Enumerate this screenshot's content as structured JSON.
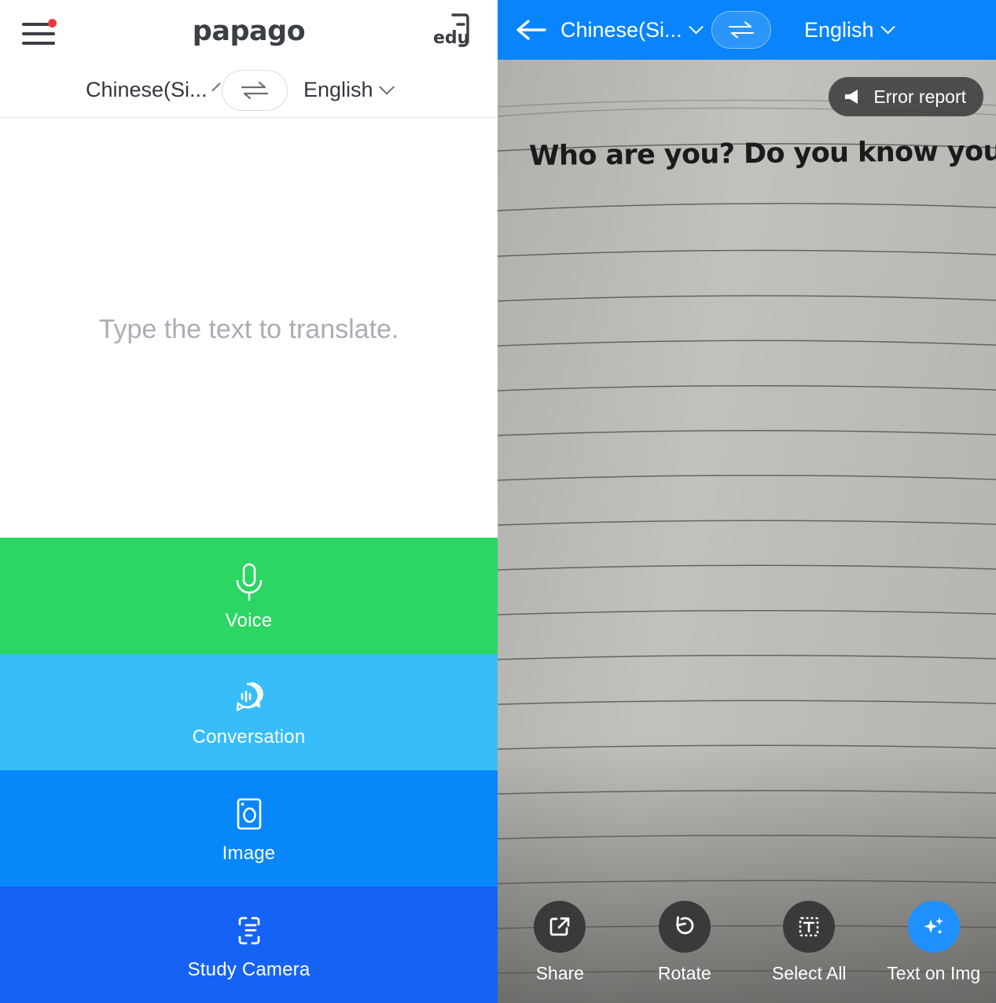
{
  "left": {
    "brand": "papago",
    "edu_label": "edu",
    "menu_icon": "hamburger-menu-icon",
    "source_language": "Chinese(Si...",
    "target_language": "English",
    "swap_icon": "swap-arrows-icon",
    "input_placeholder": "Type the text to translate.",
    "actions": [
      {
        "label": "Voice",
        "icon": "microphone-icon",
        "color": "#2bd662"
      },
      {
        "label": "Conversation",
        "icon": "conversation-bubbles-icon",
        "color": "#36bdfa"
      },
      {
        "label": "Image",
        "icon": "camera-icon",
        "color": "#0787f9"
      },
      {
        "label": "Study Camera",
        "icon": "scan-document-icon",
        "color": "#1662f5"
      }
    ]
  },
  "right": {
    "header_color": "#0a84fa",
    "back_icon": "back-arrow-icon",
    "source_language": "Chinese(Si...",
    "target_language": "English",
    "swap_icon": "swap-arrows-icon",
    "error_report_label": "Error report",
    "error_report_icon": "megaphone-icon",
    "ocr_translated_text": "Who are you? Do you know you?",
    "toolbar": [
      {
        "label": "Share",
        "icon": "share-export-icon",
        "accent": false
      },
      {
        "label": "Rotate",
        "icon": "rotate-counterclockwise-icon",
        "accent": false
      },
      {
        "label": "Select All",
        "icon": "select-all-text-icon",
        "accent": false
      },
      {
        "label": "Text on Img",
        "icon": "sparkles-icon",
        "accent": true
      }
    ]
  }
}
